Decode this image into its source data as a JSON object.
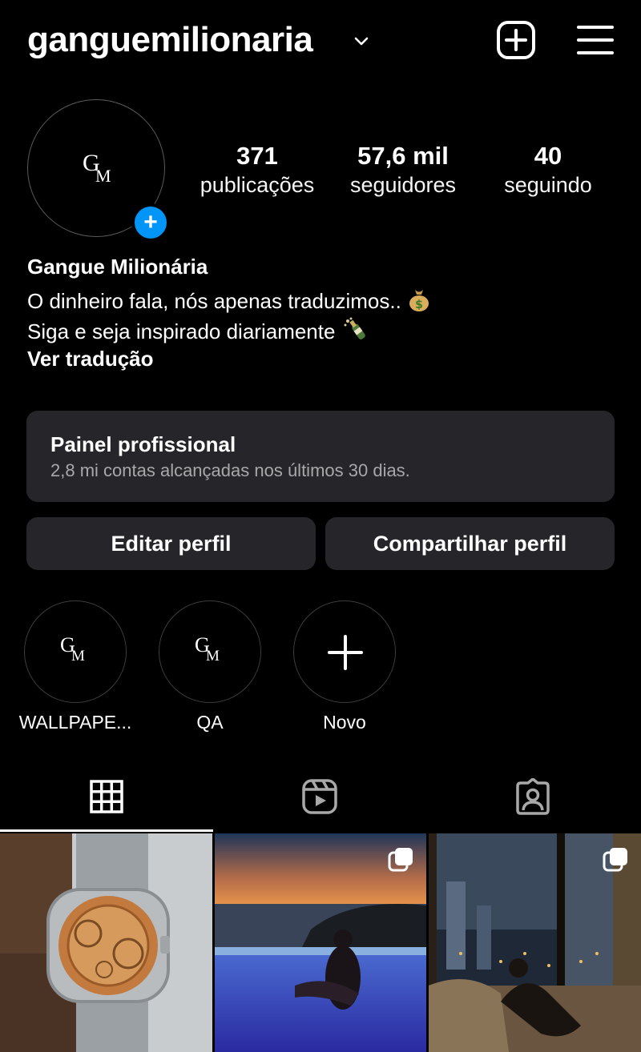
{
  "header": {
    "username": "ganguemilionaria",
    "icons": [
      "chevron-down-icon",
      "plus-square-icon",
      "hamburger-menu-icon"
    ]
  },
  "avatar": {
    "monogram_g": "G",
    "monogram_m": "M",
    "add_symbol": "+"
  },
  "stats": [
    {
      "value": "371",
      "label": "publicações"
    },
    {
      "value": "57,6 mil",
      "label": "seguidores"
    },
    {
      "value": "40",
      "label": "seguindo"
    }
  ],
  "bio": {
    "display_name": "Gangue Milionária",
    "line1": "O dinheiro fala, nós apenas traduzimos..",
    "line1_emoji": "money-bag-icon",
    "line2": "Siga e seja inspirado diariamente",
    "line2_emoji": "champagne-icon",
    "see_translation": "Ver tradução"
  },
  "pro_dashboard": {
    "title": "Painel profissional",
    "subtitle": "2,8 mi contas alcançadas nos últimos 30 dias."
  },
  "buttons": {
    "edit": "Editar perfil",
    "share": "Compartilhar perfil"
  },
  "highlights": [
    {
      "label": "WALLPAPE...",
      "monogram_g": "G",
      "monogram_m": "M"
    },
    {
      "label": "QA",
      "monogram_g": "G",
      "monogram_m": "M"
    },
    {
      "label": "Novo",
      "icon": "plus-icon"
    }
  ],
  "tabs": [
    "grid-icon",
    "reels-icon",
    "tagged-icon"
  ],
  "active_tab": 0,
  "colors": {
    "background": "#000000",
    "panel": "#26262a",
    "accent": "#0095f6",
    "secondary_text": "#a8a8a8"
  }
}
